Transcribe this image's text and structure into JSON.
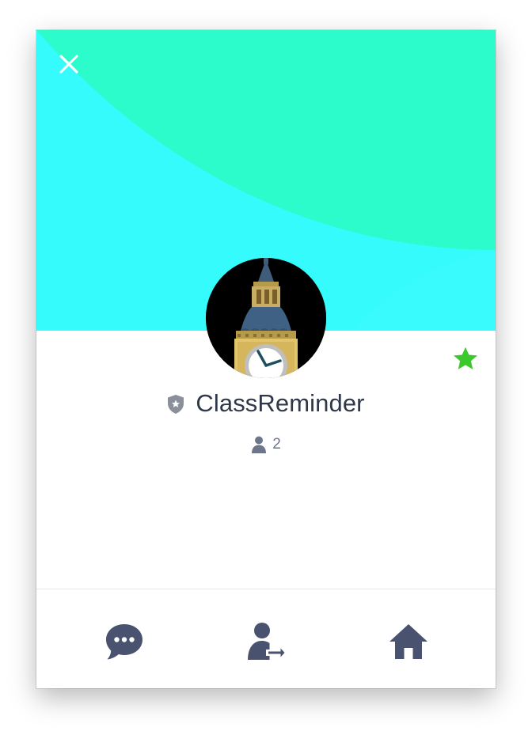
{
  "profile": {
    "name": "ClassReminder",
    "member_count": "2",
    "badge_icon": "official-shield-icon",
    "favorited": true
  },
  "colors": {
    "cover_background": "#35fbfd",
    "cover_accent": "#2cfbcc",
    "favorite_star": "#3cc92d",
    "icon_color": "#49526e",
    "text_primary": "#2f3848",
    "text_secondary": "#6e7689"
  },
  "actions": [
    {
      "name": "chat",
      "icon": "chat-bubble-icon"
    },
    {
      "name": "share-contact",
      "icon": "share-contact-icon"
    },
    {
      "name": "home",
      "icon": "home-icon"
    }
  ]
}
